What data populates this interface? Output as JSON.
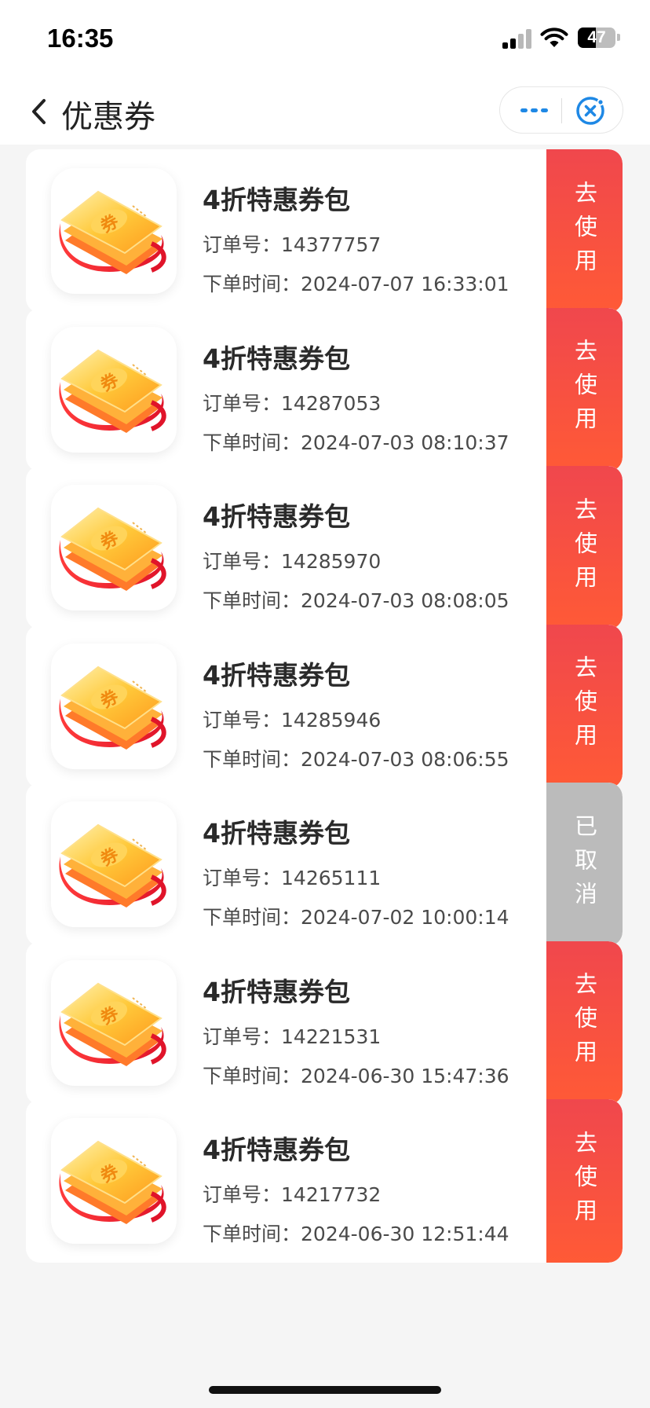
{
  "status_bar": {
    "time": "16:35",
    "battery_percent": "47",
    "icons": [
      "signal-icon",
      "wifi-icon",
      "battery-icon"
    ]
  },
  "nav": {
    "title": "优惠券",
    "back_icon": "chevron-left-icon",
    "more_icon": "more-dots-icon",
    "close_icon": "close-circle-icon"
  },
  "colors": {
    "accent_gradient_top": "#f0474d",
    "accent_gradient_bottom": "#ff5a36",
    "cancelled": "#bbbbbb",
    "nav_icon_blue": "#1e88e5"
  },
  "orders": [
    {
      "title": "4折特惠券包",
      "order_label": "订单号：",
      "order_no": "14377757",
      "time_label": "下单时间：",
      "time": "2024-07-07 16:33:01",
      "action": "去使用",
      "status": "active"
    },
    {
      "title": "4折特惠券包",
      "order_label": "订单号：",
      "order_no": "14287053",
      "time_label": "下单时间：",
      "time": "2024-07-03 08:10:37",
      "action": "去使用",
      "status": "active"
    },
    {
      "title": "4折特惠券包",
      "order_label": "订单号：",
      "order_no": "14285970",
      "time_label": "下单时间：",
      "time": "2024-07-03 08:08:05",
      "action": "去使用",
      "status": "active"
    },
    {
      "title": "4折特惠券包",
      "order_label": "订单号：",
      "order_no": "14285946",
      "time_label": "下单时间：",
      "time": "2024-07-03 08:06:55",
      "action": "去使用",
      "status": "active"
    },
    {
      "title": "4折特惠券包",
      "order_label": "订单号：",
      "order_no": "14265111",
      "time_label": "下单时间：",
      "time": "2024-07-02 10:00:14",
      "action": "已取消",
      "status": "cancelled"
    },
    {
      "title": "4折特惠券包",
      "order_label": "订单号：",
      "order_no": "14221531",
      "time_label": "下单时间：",
      "time": "2024-06-30 15:47:36",
      "action": "去使用",
      "status": "active"
    },
    {
      "title": "4折特惠券包",
      "order_label": "订单号：",
      "order_no": "14217732",
      "time_label": "下单时间：",
      "time": "2024-06-30 12:51:44",
      "action": "去使用",
      "status": "active"
    }
  ]
}
